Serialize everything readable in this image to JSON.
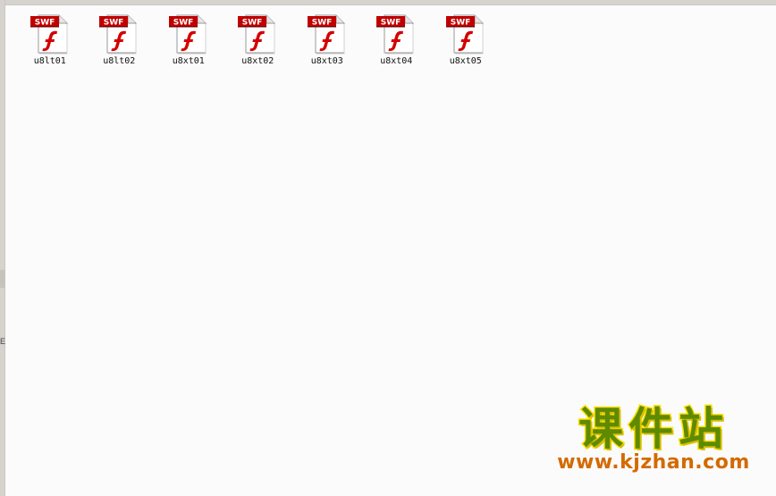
{
  "files": [
    {
      "name": "u8lt01",
      "type_badge": "SWF",
      "icon": "flash-swf-file-icon"
    },
    {
      "name": "u8lt02",
      "type_badge": "SWF",
      "icon": "flash-swf-file-icon"
    },
    {
      "name": "u8xt01",
      "type_badge": "SWF",
      "icon": "flash-swf-file-icon"
    },
    {
      "name": "u8xt02",
      "type_badge": "SWF",
      "icon": "flash-swf-file-icon"
    },
    {
      "name": "u8xt03",
      "type_badge": "SWF",
      "icon": "flash-swf-file-icon"
    },
    {
      "name": "u8xt04",
      "type_badge": "SWF",
      "icon": "flash-swf-file-icon"
    },
    {
      "name": "u8xt05",
      "type_badge": "SWF",
      "icon": "flash-swf-file-icon"
    }
  ],
  "watermark": {
    "chinese": "课件站",
    "url": "www.kjzhan.com"
  },
  "left_edge_mark": "E",
  "colors": {
    "badge_red": "#c00000",
    "flash_red": "#d40000",
    "background": "#fbfbfb",
    "watermark_green": "#5e8a00",
    "watermark_yellow": "#ffe000",
    "watermark_orange": "#d46a00"
  }
}
